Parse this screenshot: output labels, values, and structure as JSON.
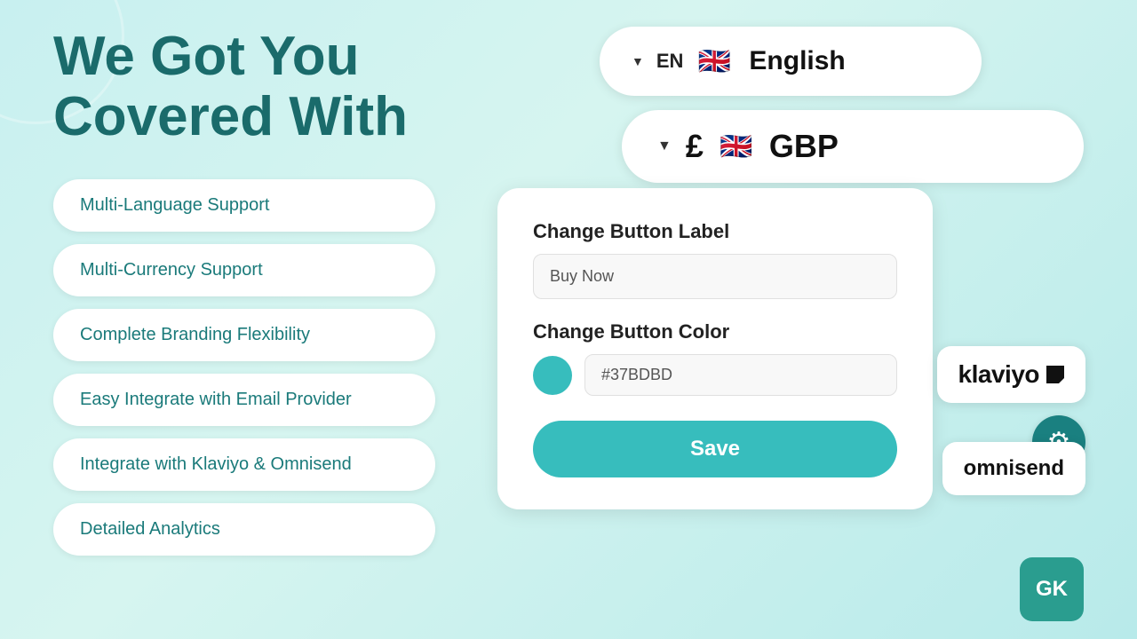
{
  "title": "We Got You Covered With",
  "features": [
    {
      "label": "Multi-Language Support"
    },
    {
      "label": "Multi-Currency Support"
    },
    {
      "label": "Complete Branding Flexibility"
    },
    {
      "label": "Easy Integrate with Email Provider"
    },
    {
      "label": "Integrate with Klaviyo & Omnisend"
    },
    {
      "label": "Detailed Analytics"
    }
  ],
  "language_selector": {
    "chevron": "▼",
    "code": "EN",
    "flag": "🇬🇧",
    "name": "English"
  },
  "currency_selector": {
    "chevron": "▼",
    "symbol": "£",
    "flag": "🇬🇧",
    "code": "GBP"
  },
  "branding_card": {
    "label_section_title": "Change Button Label",
    "label_input_value": "Buy Now",
    "label_input_placeholder": "Buy Now",
    "color_section_title": "Change Button Color",
    "color_swatch_hex": "#37BDBD",
    "color_input_value": "#37BDBD",
    "save_button_label": "Save"
  },
  "integrations": {
    "klaviyo_label": "klaviyo",
    "omnisend_label": "omnisend",
    "gear_icon": "⚙"
  }
}
